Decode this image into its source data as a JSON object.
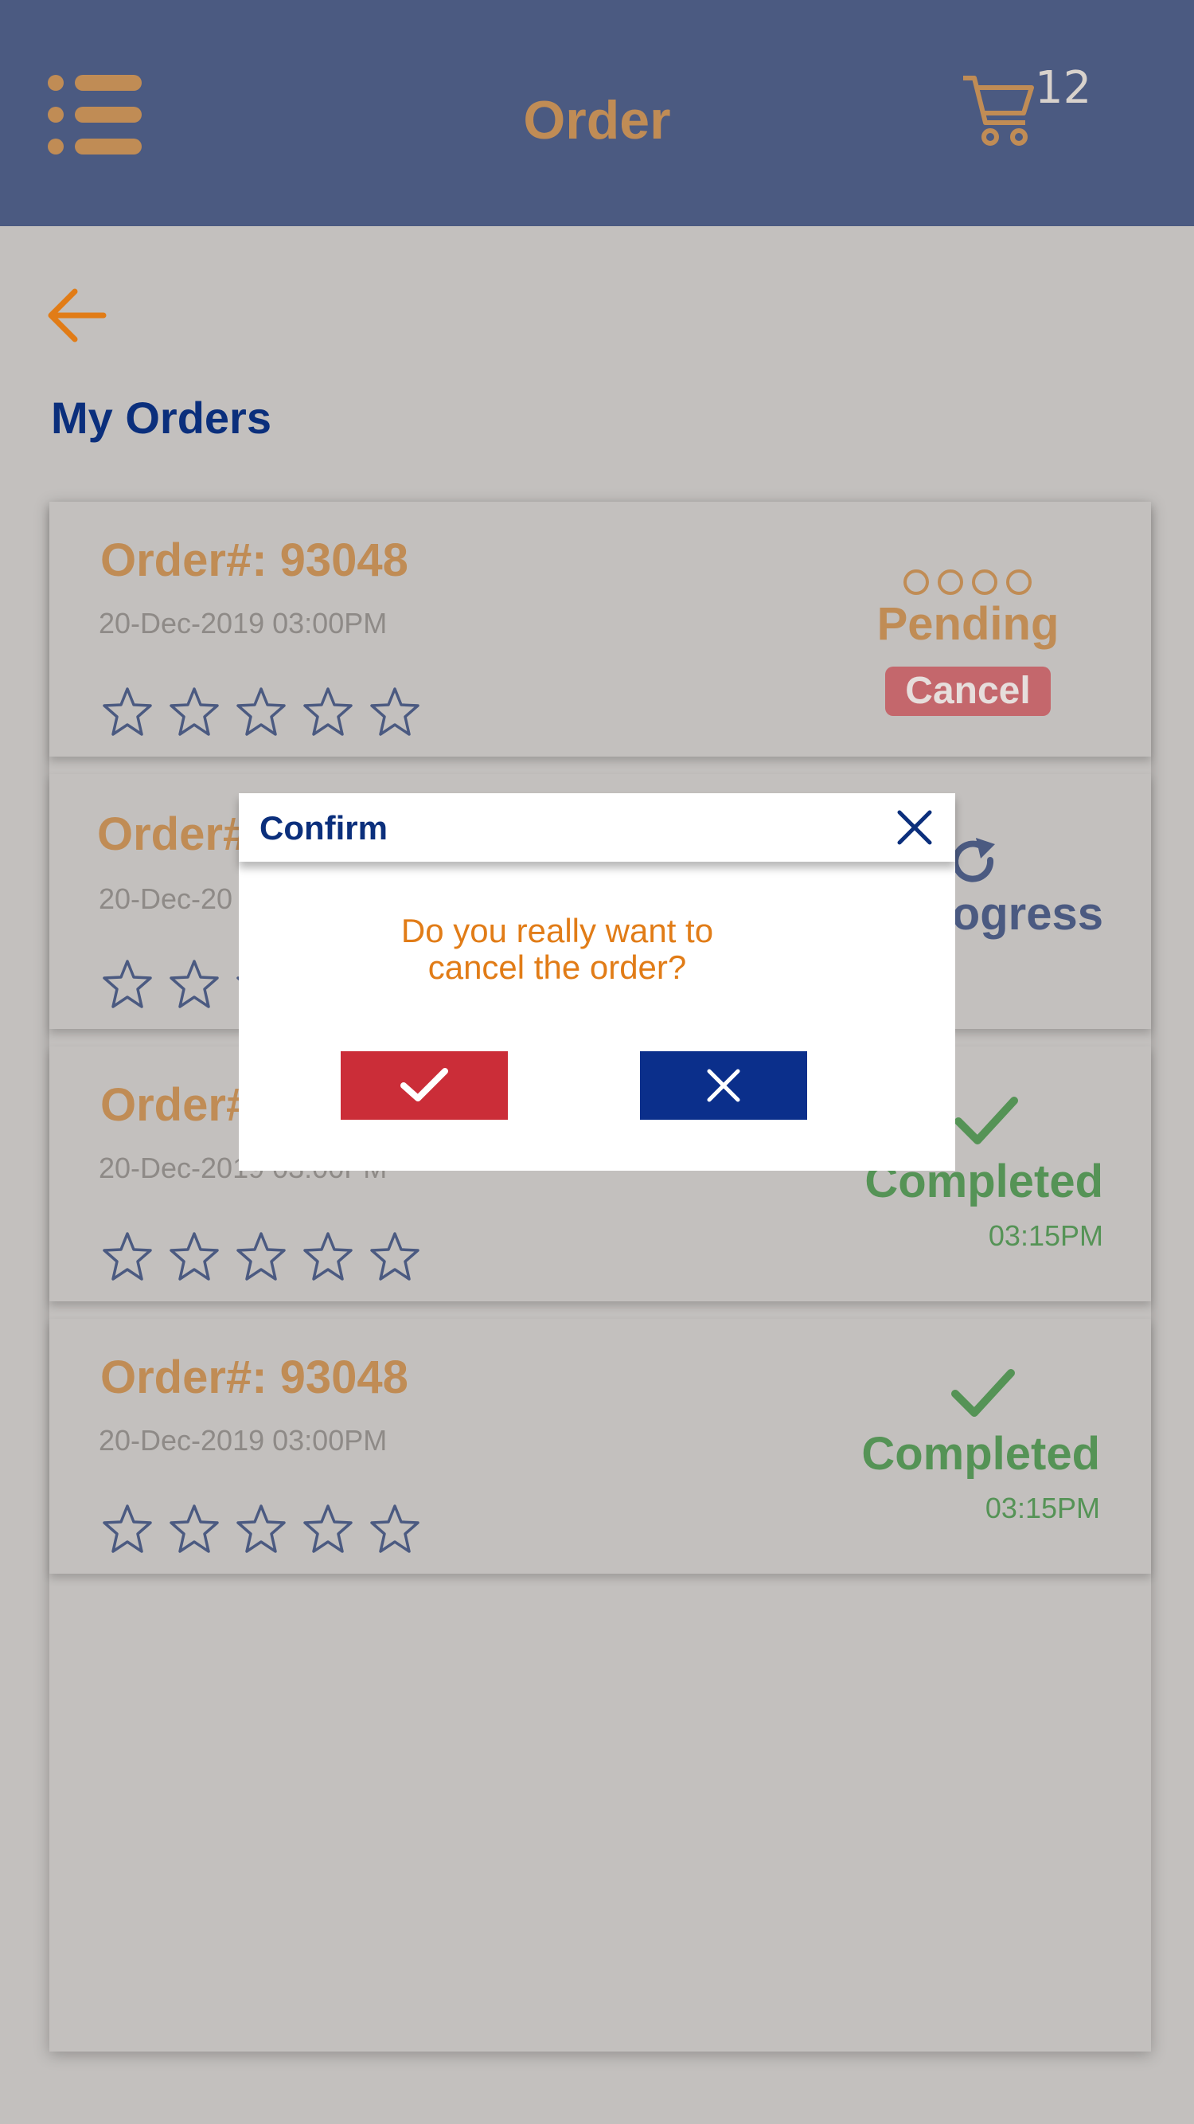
{
  "header": {
    "title": "Order",
    "menu_icon": "hamburger-menu-icon",
    "cart_icon": "shopping-cart-icon",
    "cart_count": "12"
  },
  "page": {
    "back_icon": "arrow-left-icon",
    "section_title": "My Orders"
  },
  "orders": [
    {
      "order_no": "Order#: 93048",
      "date": "20-Dec-2019 03:00PM",
      "status": "Pending",
      "action_label": "Cancel",
      "rating": 0
    },
    {
      "order_no": "Order#",
      "date": "20-Dec-20",
      "status": "rogress",
      "rating": 0
    },
    {
      "order_no": "Order#",
      "date": "20-Dec-2019 03:00PM",
      "status": "Completed",
      "time": "03:15PM",
      "rating": 0
    },
    {
      "order_no": "Order#: 93048",
      "date": "20-Dec-2019 03:00PM",
      "status": "Completed",
      "time": "03:15PM",
      "rating": 0
    }
  ],
  "dialog": {
    "title": "Confirm",
    "message_line1": "Do you really want to",
    "message_line2": "cancel the order?",
    "confirm_icon": "check-icon",
    "dismiss_icon": "close-icon"
  },
  "colors": {
    "header_bg": "#4b5a81",
    "brand_orange": "#c08c55",
    "navy": "#0b2f7c",
    "completed_green": "#559356",
    "confirm_red": "#cb2d38",
    "dismiss_blue": "#0b2f8b"
  }
}
